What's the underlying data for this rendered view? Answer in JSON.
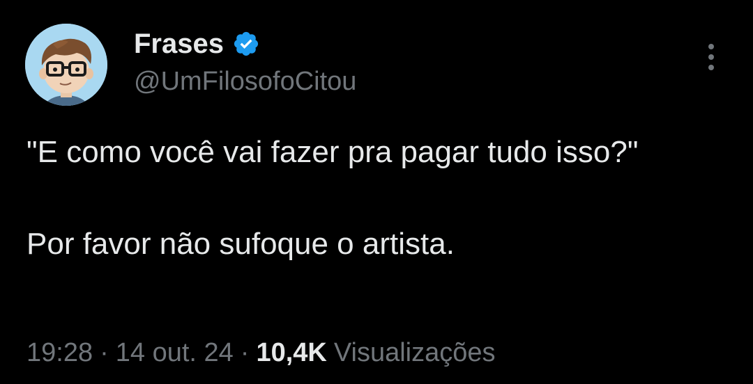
{
  "author": {
    "display_name": "Frases",
    "handle": "@UmFilosofoCitou",
    "verified": true,
    "avatar_icon": "cartoon-boy-with-glasses-avatar"
  },
  "tweet": {
    "paragraphs": [
      "\"E como você vai fazer pra pagar tudo isso?\"",
      "Por favor não sufoque o artista."
    ]
  },
  "meta": {
    "time": "19:28",
    "separator": "·",
    "date": "14 out. 24",
    "views_count": "10,4K",
    "views_label": "Visualizações"
  },
  "icons": {
    "more": "more-vertical-icon",
    "verified": "verified-badge-icon"
  },
  "colors": {
    "background": "#000000",
    "primary_text": "#e7e9ea",
    "secondary_text": "#71767b",
    "verified_blue": "#1d9bf0"
  }
}
